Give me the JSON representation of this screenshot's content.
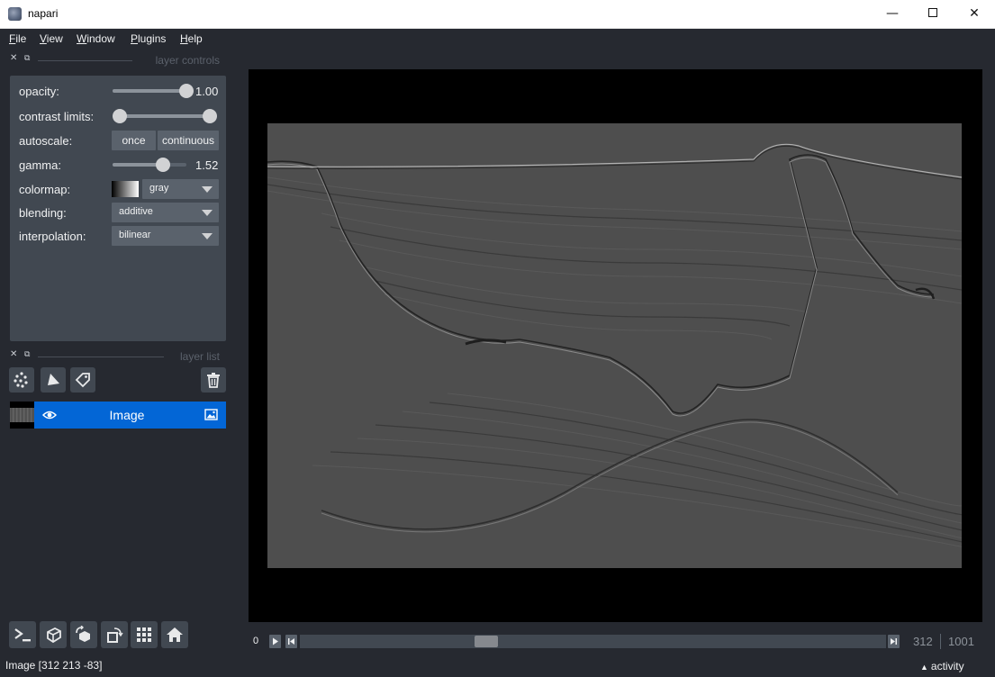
{
  "window": {
    "title": "napari"
  },
  "menu": [
    "File",
    "View",
    "Window",
    "Plugins",
    "Help"
  ],
  "layer_controls": {
    "title": "layer controls",
    "opacity": {
      "label": "opacity:",
      "value": "1.00",
      "level": 1.0
    },
    "contrast_limits": {
      "label": "contrast limits:",
      "low": 0.0,
      "high": 1.0
    },
    "autoscale": {
      "label": "autoscale:",
      "once": "once",
      "continuous": "continuous"
    },
    "gamma": {
      "label": "gamma:",
      "value": "1.52",
      "level": 0.68
    },
    "colormap": {
      "label": "colormap:",
      "value": "gray"
    },
    "blending": {
      "label": "blending:",
      "value": "additive"
    },
    "interpolation": {
      "label": "interpolation:",
      "value": "bilinear"
    }
  },
  "layer_list": {
    "title": "layer list",
    "layers": [
      {
        "name": "Image",
        "visible": true,
        "type": "image"
      }
    ]
  },
  "dims": {
    "axis": "0",
    "current": "312",
    "total": "1001",
    "position_fraction": 0.311
  },
  "status": {
    "text": "Image [312 213 -83]",
    "activity": "activity"
  },
  "colors": {
    "background": "#262930",
    "panel": "#414851",
    "accent": "#0366d6",
    "control": "#5a626c"
  }
}
